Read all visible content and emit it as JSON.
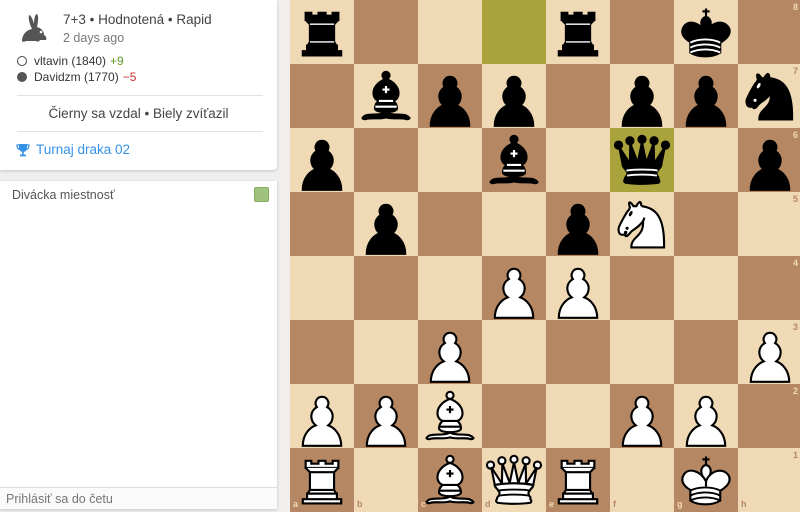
{
  "game": {
    "title": "7+3 • Hodnotená • Rapid",
    "ago": "2 days ago",
    "icon": "rabbit-icon",
    "white": {
      "name": "vltavin (1840)",
      "diff": "+9"
    },
    "black": {
      "name": "Davidzm (1770)",
      "diff": "−5"
    },
    "result": "Čierny sa vzdal • Biely zvíťazil",
    "tournament": "Turnaj draka 02"
  },
  "chat": {
    "title": "Divácka miestnosť",
    "placeholder": "Prihlásiť sa do četu"
  },
  "board": {
    "files": [
      "a",
      "b",
      "c",
      "d",
      "e",
      "f",
      "g",
      "h"
    ],
    "ranks": [
      "8",
      "7",
      "6",
      "5",
      "4",
      "3",
      "2",
      "1"
    ],
    "highlights": [
      "d8",
      "f6"
    ],
    "pieces": [
      {
        "sq": "a8",
        "type": "rook",
        "color": "black"
      },
      {
        "sq": "e8",
        "type": "rook",
        "color": "black"
      },
      {
        "sq": "g8",
        "type": "king",
        "color": "black"
      },
      {
        "sq": "b7",
        "type": "bishop",
        "color": "black"
      },
      {
        "sq": "c7",
        "type": "pawn",
        "color": "black"
      },
      {
        "sq": "d7",
        "type": "pawn",
        "color": "black"
      },
      {
        "sq": "f7",
        "type": "pawn",
        "color": "black"
      },
      {
        "sq": "g7",
        "type": "pawn",
        "color": "black"
      },
      {
        "sq": "h7",
        "type": "knight",
        "color": "black"
      },
      {
        "sq": "a6",
        "type": "pawn",
        "color": "black"
      },
      {
        "sq": "d6",
        "type": "bishop",
        "color": "black"
      },
      {
        "sq": "f6",
        "type": "queen",
        "color": "black"
      },
      {
        "sq": "h6",
        "type": "pawn",
        "color": "black"
      },
      {
        "sq": "b5",
        "type": "pawn",
        "color": "black"
      },
      {
        "sq": "e5",
        "type": "pawn",
        "color": "black"
      },
      {
        "sq": "f5",
        "type": "knight",
        "color": "white"
      },
      {
        "sq": "d4",
        "type": "pawn",
        "color": "white"
      },
      {
        "sq": "e4",
        "type": "pawn",
        "color": "white"
      },
      {
        "sq": "c3",
        "type": "pawn",
        "color": "white"
      },
      {
        "sq": "h3",
        "type": "pawn",
        "color": "white"
      },
      {
        "sq": "a2",
        "type": "pawn",
        "color": "white"
      },
      {
        "sq": "b2",
        "type": "pawn",
        "color": "white"
      },
      {
        "sq": "c2",
        "type": "bishop",
        "color": "white"
      },
      {
        "sq": "f2",
        "type": "pawn",
        "color": "white"
      },
      {
        "sq": "g2",
        "type": "pawn",
        "color": "white"
      },
      {
        "sq": "a1",
        "type": "rook",
        "color": "white"
      },
      {
        "sq": "c1",
        "type": "bishop",
        "color": "white"
      },
      {
        "sq": "d1",
        "type": "queen",
        "color": "white"
      },
      {
        "sq": "e1",
        "type": "rook",
        "color": "white"
      },
      {
        "sq": "g1",
        "type": "king",
        "color": "white"
      }
    ]
  }
}
